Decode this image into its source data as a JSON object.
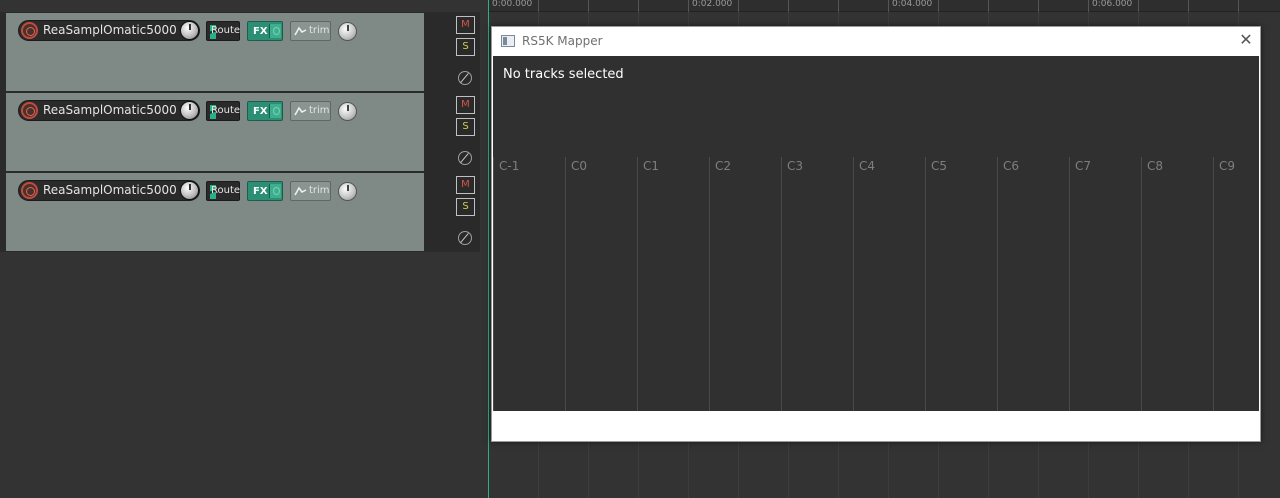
{
  "tracks": [
    {
      "name": "ReaSamplOmatic5000",
      "route_label": "Route",
      "fx_label": "FX",
      "trim_label": "trim",
      "mute_label": "M",
      "solo_label": "S"
    },
    {
      "name": "ReaSamplOmatic5000",
      "route_label": "Route",
      "fx_label": "FX",
      "trim_label": "trim",
      "mute_label": "M",
      "solo_label": "S"
    },
    {
      "name": "ReaSamplOmatic5000",
      "route_label": "Route",
      "fx_label": "FX",
      "trim_label": "trim",
      "mute_label": "M",
      "solo_label": "S"
    }
  ],
  "ruler": {
    "labels": [
      "0:00.000",
      "0:02.000",
      "0:04.000",
      "0:06.000"
    ]
  },
  "mapper": {
    "title": "RS5K Mapper",
    "close_icon": "close-icon",
    "status": "No tracks selected",
    "octaves": [
      "C-1",
      "C0",
      "C1",
      "C2",
      "C3",
      "C4",
      "C5",
      "C6",
      "C7",
      "C8",
      "C9"
    ]
  },
  "colors": {
    "track_panel": "#7f8a87",
    "fx_active": "#2c8e74",
    "edit_cursor": "#2bb08a",
    "record_arm": "#c04a3c"
  }
}
